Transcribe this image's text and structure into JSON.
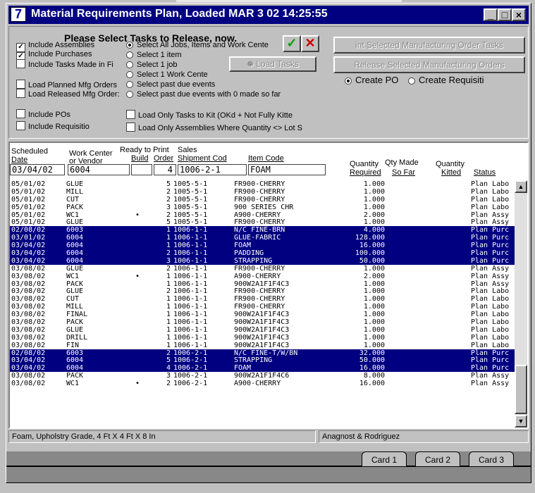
{
  "window": {
    "title": "Material Requirements Plan,  Loaded MAR 3 02  14:25:55",
    "app_icon": "7"
  },
  "options": {
    "heading": "Please Select Tasks to Release, now.",
    "checkboxes": [
      {
        "label": "Include Assemblies",
        "checked": true
      },
      {
        "label": "Include Purchases",
        "checked": true
      },
      {
        "label": "Include Tasks Made in Fi",
        "checked": false
      },
      {
        "label": "Load Planned Mfg Orders",
        "checked": false
      },
      {
        "label": "Load Released Mfg Order:",
        "checked": false
      },
      {
        "label": "Include POs",
        "checked": false
      },
      {
        "label": "Include Requisitio",
        "checked": false
      }
    ],
    "radios": [
      {
        "label": "Select All Jobs, Items and Work Cente",
        "selected": true
      },
      {
        "label": "Select 1 item",
        "selected": false
      },
      {
        "label": "Select 1 job",
        "selected": false
      },
      {
        "label": "Select 1 Work Cente",
        "selected": false
      },
      {
        "label": "Select past due events",
        "selected": false
      },
      {
        "label": "Select past due events with 0 made so far",
        "selected": false
      }
    ],
    "kit_checks": [
      {
        "label": "Load Only Tasks to Kit (OKd + Not Fully Kitte",
        "checked": false
      },
      {
        "label": "Load Only Assemblies Where Quantity <> Lot S",
        "checked": false
      }
    ],
    "load_tasks": "Load Tasks",
    "print_button": "int Selected Manufacturing Order Tasks",
    "release_button": "Release Selected Manufacturing Orders",
    "create_radios": [
      {
        "label": "Create PO",
        "selected": true
      },
      {
        "label": "Create Requisiti",
        "selected": false
      }
    ]
  },
  "table": {
    "headers": {
      "sched_1": "Scheduled",
      "sched_2": "Date",
      "wc_1": "Work Center",
      "wc_2": "or Vendor",
      "ready": "Ready to Print",
      "build": "Build",
      "order": "Order",
      "sales": "Sales",
      "shipment": "Shipment Cod",
      "item": "Item Code",
      "qty_1": "Quantity",
      "qty_2": "Required",
      "made_1": "Qty Made",
      "made_2": "So Far",
      "kit_1": "Quantity",
      "kit_2": "Kitted",
      "status": "Status"
    },
    "filters": {
      "date": "03/04/02",
      "wc": "6004",
      "build": "",
      "order": "4",
      "shipment": "1006-2-1",
      "item": "FOAM"
    },
    "rows": [
      {
        "date": "05/01/02",
        "wc": "GLUE",
        "bullet": "",
        "order": "5",
        "ship": "1005-5-1",
        "item": "FR900-CHERRY",
        "qty": "1.000",
        "status": "Plan Labo",
        "sel": false
      },
      {
        "date": "05/01/02",
        "wc": "MILL",
        "bullet": "",
        "order": "2",
        "ship": "1005-5-1",
        "item": "FR900-CHERRY",
        "qty": "1.000",
        "status": "Plan Labo",
        "sel": false
      },
      {
        "date": "05/01/02",
        "wc": "CUT",
        "bullet": "",
        "order": "2",
        "ship": "1005-5-1",
        "item": "FR900-CHERRY",
        "qty": "1.000",
        "status": "Plan Labo",
        "sel": false
      },
      {
        "date": "05/01/02",
        "wc": "PACK",
        "bullet": "",
        "order": "3",
        "ship": "1005-5-1",
        "item": "900 SERIES CHR",
        "qty": "1.000",
        "status": "Plan Labo",
        "sel": false
      },
      {
        "date": "05/01/02",
        "wc": "WC1",
        "bullet": "•",
        "order": "2",
        "ship": "1005-5-1",
        "item": "A900-CHERRY",
        "qty": "2.000",
        "status": "Plan Assy",
        "sel": false
      },
      {
        "date": "05/01/02",
        "wc": "GLUE",
        "bullet": "",
        "order": "5",
        "ship": "1005-5-1",
        "item": "FR900-CHERRY",
        "qty": "1.000",
        "status": "Plan Assy",
        "sel": false
      },
      {
        "date": "02/08/02",
        "wc": "6003",
        "bullet": "",
        "order": "1",
        "ship": "1006-1-1",
        "item": "N/C FINE-BRN",
        "qty": "4.000",
        "status": "Plan Purc",
        "sel": true
      },
      {
        "date": "03/01/02",
        "wc": "6004",
        "bullet": "",
        "order": "1",
        "ship": "1006-1-1",
        "item": "GLUE-FABRIC",
        "qty": "128.000",
        "status": "Plan Purc",
        "sel": true
      },
      {
        "date": "03/04/02",
        "wc": "6004",
        "bullet": "",
        "order": "1",
        "ship": "1006-1-1",
        "item": "FOAM",
        "qty": "16.000",
        "status": "Plan Purc",
        "sel": true
      },
      {
        "date": "03/04/02",
        "wc": "6004",
        "bullet": "",
        "order": "2",
        "ship": "1006-1-1",
        "item": "PADDING",
        "qty": "100.000",
        "status": "Plan Purc",
        "sel": true
      },
      {
        "date": "03/04/02",
        "wc": "6004",
        "bullet": "",
        "order": "3",
        "ship": "1006-1-1",
        "item": "STRAPPING",
        "qty": "50.000",
        "status": "Plan Purc",
        "sel": true
      },
      {
        "date": "03/08/02",
        "wc": "GLUE",
        "bullet": "",
        "order": "2",
        "ship": "1006-1-1",
        "item": "FR900-CHERRY",
        "qty": "1.000",
        "status": "Plan Assy",
        "sel": false
      },
      {
        "date": "03/08/02",
        "wc": "WC1",
        "bullet": "•",
        "order": "1",
        "ship": "1006-1-1",
        "item": "A900-CHERRY",
        "qty": "2.000",
        "status": "Plan Assy",
        "sel": false
      },
      {
        "date": "03/08/02",
        "wc": "PACK",
        "bullet": "",
        "order": "1",
        "ship": "1006-1-1",
        "item": "900W2A1F1F4C3",
        "qty": "1.000",
        "status": "Plan Assy",
        "sel": false
      },
      {
        "date": "03/08/02",
        "wc": "GLUE",
        "bullet": "",
        "order": "2",
        "ship": "1006-1-1",
        "item": "FR900-CHERRY",
        "qty": "1.000",
        "status": "Plan Labo",
        "sel": false
      },
      {
        "date": "03/08/02",
        "wc": "CUT",
        "bullet": "",
        "order": "1",
        "ship": "1006-1-1",
        "item": "FR900-CHERRY",
        "qty": "1.000",
        "status": "Plan Labo",
        "sel": false
      },
      {
        "date": "03/08/02",
        "wc": "MILL",
        "bullet": "",
        "order": "1",
        "ship": "1006-1-1",
        "item": "FR900-CHERRY",
        "qty": "1.000",
        "status": "Plan Labo",
        "sel": false
      },
      {
        "date": "03/08/02",
        "wc": "FINAL",
        "bullet": "",
        "order": "1",
        "ship": "1006-1-1",
        "item": "900W2A1F1F4C3",
        "qty": "1.000",
        "status": "Plan Labo",
        "sel": false
      },
      {
        "date": "03/08/02",
        "wc": "PACK",
        "bullet": "",
        "order": "1",
        "ship": "1006-1-1",
        "item": "900W2A1F1F4C3",
        "qty": "1.000",
        "status": "Plan Labo",
        "sel": false
      },
      {
        "date": "03/08/02",
        "wc": "GLUE",
        "bullet": "",
        "order": "1",
        "ship": "1006-1-1",
        "item": "900W2A1F1F4C3",
        "qty": "1.000",
        "status": "Plan Labo",
        "sel": false
      },
      {
        "date": "03/08/02",
        "wc": "DRILL",
        "bullet": "",
        "order": "1",
        "ship": "1006-1-1",
        "item": "900W2A1F1F4C3",
        "qty": "1.000",
        "status": "Plan Labo",
        "sel": false
      },
      {
        "date": "03/08/02",
        "wc": "FIN",
        "bullet": "",
        "order": "1",
        "ship": "1006-1-1",
        "item": "900W2A1F1F4C3",
        "qty": "1.000",
        "status": "Plan Labo",
        "sel": false
      },
      {
        "date": "02/08/02",
        "wc": "6003",
        "bullet": "",
        "order": "2",
        "ship": "1006-2-1",
        "item": "N/C FINE-T/W/BN",
        "qty": "32.000",
        "status": "Plan Purc",
        "sel": true
      },
      {
        "date": "03/04/02",
        "wc": "6004",
        "bullet": "",
        "order": "5",
        "ship": "1006-2-1",
        "item": "STRAPPING",
        "qty": "50.000",
        "status": "Plan Purc",
        "sel": true
      },
      {
        "date": "03/04/02",
        "wc": "6004",
        "bullet": "",
        "order": "4",
        "ship": "1006-2-1",
        "item": "FOAM",
        "qty": "16.000",
        "status": "Plan Purc",
        "sel": true
      },
      {
        "date": "03/08/02",
        "wc": "PACK",
        "bullet": "",
        "order": "3",
        "ship": "1006-2-1",
        "item": "900W2A1F1F4C6",
        "qty": "8.000",
        "status": "Plan Assy",
        "sel": false
      },
      {
        "date": "03/08/02",
        "wc": "WC1",
        "bullet": "•",
        "order": "2",
        "ship": "1006-2-1",
        "item": "A900-CHERRY",
        "qty": "16.000",
        "status": "Plan Assy",
        "sel": false
      }
    ]
  },
  "status": {
    "description": "Foam, Upholstry Grade, 4 Ft X 4 Ft X 8 In",
    "vendor": "Anagnost & Rodriguez"
  },
  "tabs": [
    "Card 1",
    "Card 2",
    "Card 3"
  ],
  "colors": {
    "selection": "#000080",
    "title_bar": "#000080",
    "ok_check": "#00a000",
    "cancel_x": "#d00000"
  }
}
